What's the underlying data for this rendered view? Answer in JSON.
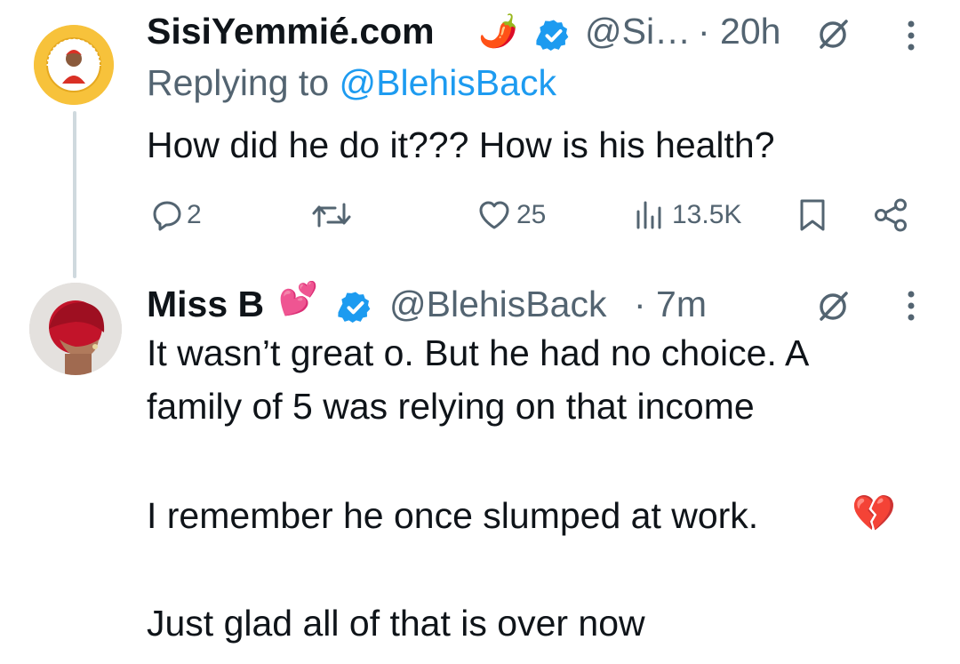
{
  "tweet1": {
    "author_name": "SisiYemmié.com",
    "author_emoji": "🌶️",
    "handle": "@Si…",
    "time": "· 20h",
    "replying_prefix": "Replying to ",
    "replying_handle": "@BlehisBack",
    "text": "How did he do it??? How is his health?",
    "avatar_icon": "sisiyemmie-logo",
    "actions": {
      "reply_count": "2",
      "retweet_count": "",
      "like_count": "25",
      "view_count": "13.5K"
    }
  },
  "tweet2": {
    "author_name": "Miss B",
    "author_emoji": "💕",
    "handle": "@BlehisBack",
    "time": "· 7m",
    "avatar_icon": "profile-photo",
    "lines": [
      "It wasn’t great o. But he had no choice. A",
      "family of 5 was relying on that income",
      "I remember he once slumped at work.",
      "Just glad all of that is over now"
    ],
    "emoji_broken_heart": "💔"
  },
  "colors": {
    "text_primary": "#0f1419",
    "text_secondary": "#536471",
    "link": "#1d9bf0",
    "verified": "#1d9bf0",
    "thread_line": "#cfd9de"
  }
}
